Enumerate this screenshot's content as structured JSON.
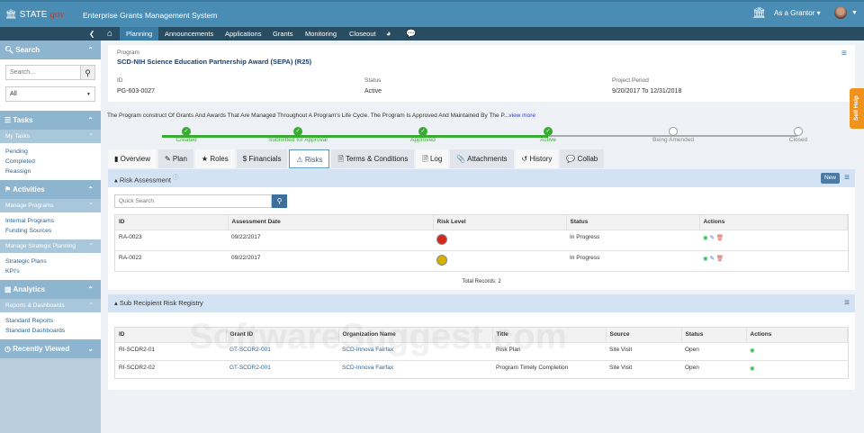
{
  "header": {
    "logo_text": "STATE",
    "logo_suffix": "gov",
    "app_title": "Enterprise Grants Management System",
    "role": "As a Grantor"
  },
  "nav": {
    "items": [
      "Planning",
      "Announcements",
      "Applications",
      "Grants",
      "Monitoring",
      "Closeout"
    ],
    "active": "Planning"
  },
  "sidebar": {
    "search": {
      "title": "Search",
      "placeholder": "Search...",
      "filter": "All"
    },
    "tasks": {
      "title": "Tasks",
      "sub": "My Tasks",
      "links": [
        "Pending",
        "Completed",
        "Reassign"
      ]
    },
    "activities": {
      "title": "Activities",
      "groups": [
        {
          "title": "Manage Programs",
          "links": [
            "Internal Programs",
            "Funding Sources"
          ]
        },
        {
          "title": "Manage Strategic Planning",
          "links": [
            "Strategic Plans",
            "KPI's"
          ]
        }
      ]
    },
    "analytics": {
      "title": "Analytics",
      "sub": "Reports & Dashboards",
      "links": [
        "Standard Reports",
        "Standard Dashboards"
      ]
    },
    "recent": {
      "title": "Recently Viewed"
    }
  },
  "program": {
    "label": "Program",
    "name": "SCD-NIH Science Education Partnership Award (SEPA) (R25)",
    "id_label": "ID",
    "id": "PG-603-0027",
    "status_label": "Status",
    "status": "Active",
    "period_label": "Project Period",
    "period": "9/20/2017 To 12/31/2018"
  },
  "description": {
    "text": "The Program construct Of Grants And Awards That Are Managed Throughout A Program's Life Cycle. The Program Is Approved And Maintained By The P...",
    "more": "view more"
  },
  "lifecycle": [
    {
      "label": "Created",
      "done": true
    },
    {
      "label": "Submitted for Approval",
      "done": true
    },
    {
      "label": "Approved",
      "done": true
    },
    {
      "label": "Active",
      "done": true
    },
    {
      "label": "Being Amended",
      "done": false
    },
    {
      "label": "Closed",
      "done": false
    }
  ],
  "tabs": [
    "Overview",
    "Plan",
    "Roles",
    "Financials",
    "Risks",
    "Terms & Conditions",
    "Log",
    "Attachments",
    "History",
    "Collab"
  ],
  "active_tab": "Risks",
  "risk": {
    "title": "Risk Assessment",
    "new_label": "New",
    "search_placeholder": "Quick Search",
    "columns": [
      "ID",
      "Assessment Date",
      "Risk Level",
      "Status",
      "Actions"
    ],
    "rows": [
      {
        "id": "RA-0023",
        "date": "09/22/2017",
        "level_color": "#d7261e",
        "status": "In Progress"
      },
      {
        "id": "RA-0022",
        "date": "09/22/2017",
        "level_color": "#d4b000",
        "status": "In Progress"
      }
    ],
    "total": "Total Records: 2"
  },
  "registry": {
    "title": "Sub Recipient Risk Registry",
    "columns": [
      "ID",
      "Grant ID",
      "Organization Name",
      "Title",
      "Source",
      "Status",
      "Actions"
    ],
    "rows": [
      {
        "id": "RI-SCDR2-01",
        "grant": "GT-SCDR2-001",
        "org": "SCD-Innova Fairfax",
        "title": "Risk Plan",
        "source": "Site Visit",
        "status": "Open"
      },
      {
        "id": "RI-SCDR2-02",
        "grant": "GT-SCDR2-001",
        "org": "SCD-Innova Fairfax",
        "title": "Program Timely Completion",
        "source": "Site Visit",
        "status": "Open"
      }
    ]
  },
  "self_help": "Self Help",
  "watermark": "SoftwareSuggest.com"
}
